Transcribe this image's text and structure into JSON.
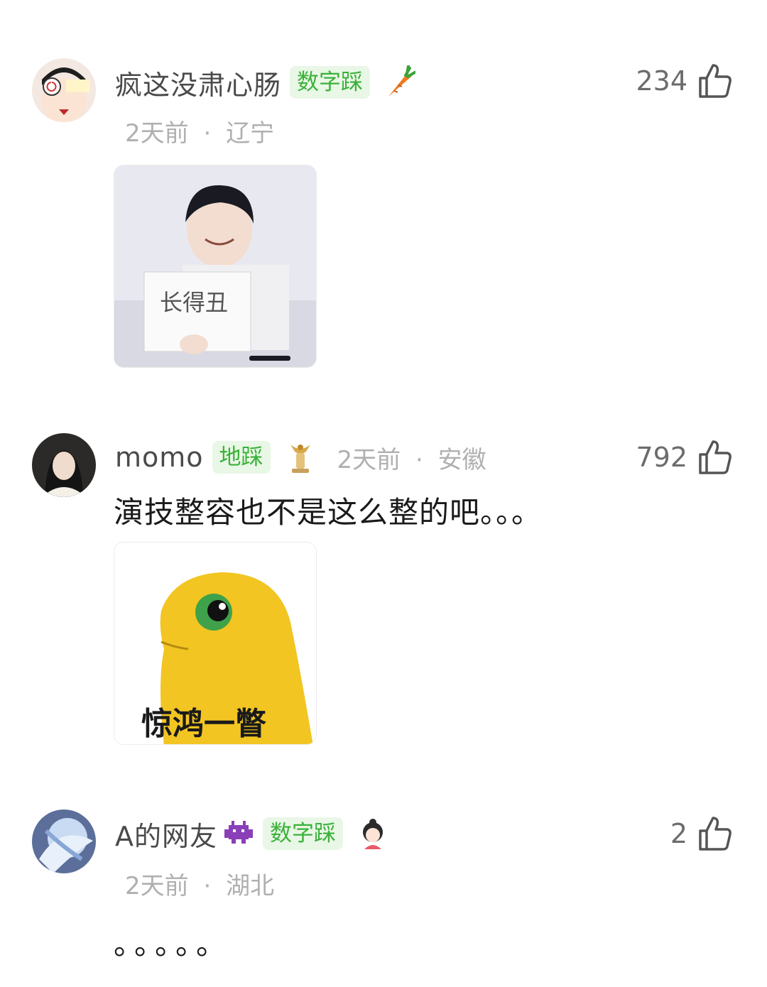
{
  "comments": [
    {
      "username": "疯这没肃心肠",
      "badge": "数字踩",
      "decoration_icon": "carrot-icon",
      "time": "2天前",
      "location": "辽宁",
      "likes": "234",
      "body": "",
      "sticker_caption": "长得丑"
    },
    {
      "username": "momo",
      "badge": "地踩",
      "decoration_icon": "trophy-icon",
      "time": "2天前",
      "location": "安徽",
      "likes": "792",
      "body": "演技整容也不是这么整的吧。。。",
      "sticker_caption": "惊鸿一瞥"
    },
    {
      "username": "A的网友",
      "badge": "数字踩",
      "decoration_icon": "alien-icon",
      "time": "2天前",
      "location": "湖北",
      "likes": "2",
      "body": "。。。。。",
      "sticker_caption": ""
    }
  ],
  "separator": "·",
  "colors": {
    "badge_text": "#3bb13a",
    "badge_bg": "#e9f7e6",
    "meta": "#b0b0b0",
    "like": "#6c6c6c"
  }
}
